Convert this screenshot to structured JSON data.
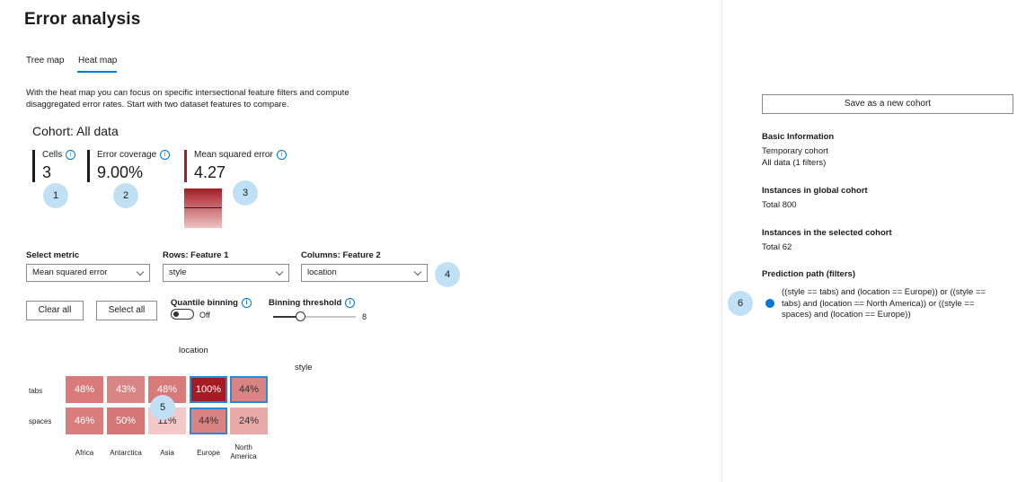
{
  "page": {
    "title": "Error analysis",
    "tabs": [
      {
        "label": "Tree map"
      },
      {
        "label": "Heat map"
      }
    ],
    "active_tab": "Heat map",
    "description": "With the heat map you can focus on specific intersectional feature filters and compute disaggregated error rates. Start with two dataset features to compare.",
    "cohort_title": "Cohort: All data"
  },
  "metrics": [
    {
      "label": "Cells",
      "value": "3"
    },
    {
      "label": "Error coverage",
      "value": "9.00%"
    },
    {
      "label": "Mean squared error",
      "value": "4.27"
    }
  ],
  "callouts": [
    "1",
    "2",
    "3",
    "4",
    "5",
    "6"
  ],
  "controls": {
    "select_metric_label": "Select metric",
    "select_metric_value": "Mean squared error",
    "rows_label": "Rows: Feature 1",
    "rows_value": "style",
    "columns_label": "Columns: Feature 2",
    "columns_value": "location",
    "clear_all": "Clear all",
    "select_all": "Select all",
    "quantile_binning_label": "Quantile binning",
    "quantile_binning_state": "Off",
    "binning_threshold_label": "Binning threshold",
    "binning_threshold_value": "8"
  },
  "heatmap": {
    "column_feature": "location",
    "row_feature": "style",
    "columns": [
      "Africa",
      "Antarctica",
      "Asia",
      "Europe",
      "North America"
    ],
    "rows": [
      {
        "label": "tabs",
        "cells": [
          {
            "value": "48%",
            "color": "#d87a7a",
            "selected": false
          },
          {
            "value": "43%",
            "color": "#d98585",
            "selected": false
          },
          {
            "value": "48%",
            "color": "#d87a7a",
            "selected": false
          },
          {
            "value": "100%",
            "color": "#a51b24",
            "selected": true
          },
          {
            "value": "44%",
            "color": "#d98383",
            "selected": true
          }
        ]
      },
      {
        "label": "spaces",
        "cells": [
          {
            "value": "46%",
            "color": "#d87e7e",
            "selected": false
          },
          {
            "value": "50%",
            "color": "#d67575",
            "selected": false
          },
          {
            "value": "11%",
            "color": "#f2c8c8",
            "selected": false
          },
          {
            "value": "44%",
            "color": "#d98383",
            "selected": true
          },
          {
            "value": "24%",
            "color": "#e8a9a9",
            "selected": false
          }
        ]
      }
    ]
  },
  "right_panel": {
    "save_button": "Save as a new cohort",
    "basic_info_heading": "Basic Information",
    "basic_info_lines": [
      "Temporary cohort",
      "All data (1 filters)"
    ],
    "global_heading": "Instances in global cohort",
    "global_total": "Total 800",
    "selected_heading": "Instances in the selected cohort",
    "selected_total": "Total 62",
    "prediction_heading": "Prediction path (filters)",
    "prediction_path": "((style == tabs) and (location == Europe)) or ((style == tabs) and (location == North America)) or ((style == spaces) and (location == Europe))"
  },
  "colors": {
    "accent": "#0078d4",
    "selection_border": "#2b88d8",
    "callout": "#bfe0f5",
    "mse_bar": "#a51b24"
  }
}
